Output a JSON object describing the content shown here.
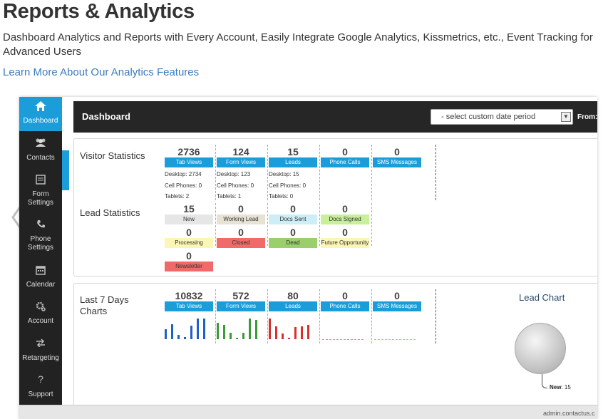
{
  "page": {
    "title": "Reports & Analytics",
    "description": "Dashboard Analytics and Reports with Every Account, Easily Integrate Google Analytics, Kissmetrics, etc., Event Tracking for Advanced Users",
    "link": "Learn More About Our Analytics Features"
  },
  "sidebar": {
    "items": [
      {
        "label": "Dashboard",
        "icon": "home-icon"
      },
      {
        "label": "Contacts",
        "icon": "users-icon"
      },
      {
        "label": "Form Settings",
        "icon": "form-icon"
      },
      {
        "label": "Phone Settings",
        "icon": "phone-icon"
      },
      {
        "label": "Calendar",
        "icon": "calendar-icon"
      },
      {
        "label": "Account",
        "icon": "gear-icon"
      },
      {
        "label": "Retargeting",
        "icon": "retarget-icon"
      },
      {
        "label": "Support",
        "icon": "question-icon"
      }
    ]
  },
  "header": {
    "title": "Dashboard",
    "date_select": "- select custom date period",
    "from_label": "From:"
  },
  "visitor_stats": {
    "label": "Visitor Statistics",
    "items": [
      {
        "value": "2736",
        "label": "Tab Views",
        "desktop": "Desktop: 2734",
        "cell": "Cell Phones: 0",
        "tablets": "Tablets: 2"
      },
      {
        "value": "124",
        "label": "Form Views",
        "desktop": "Desktop: 123",
        "cell": "Cell Phones: 0",
        "tablets": "Tablets: 1"
      },
      {
        "value": "15",
        "label": "Leads",
        "desktop": "Desktop: 15",
        "cell": "Cell Phones: 0",
        "tablets": "Tablets: 0"
      },
      {
        "value": "0",
        "label": "Phone Calls"
      },
      {
        "value": "0",
        "label": "SMS Messages"
      }
    ]
  },
  "lead_stats": {
    "label": "Lead Statistics",
    "items": [
      {
        "value": "15",
        "label": "New",
        "color": "#e6e6e6"
      },
      {
        "value": "0",
        "label": "Working Lead",
        "color": "#e8e2d4"
      },
      {
        "value": "0",
        "label": "Docs Sent",
        "color": "#cdeef6"
      },
      {
        "value": "0",
        "label": "Docs Signed",
        "color": "#c8ef9a"
      },
      {
        "value": "0",
        "label": "Processing",
        "color": "#fbf6b5"
      },
      {
        "value": "0",
        "label": "Closed",
        "color": "#f06a6a"
      },
      {
        "value": "0",
        "label": "Dead",
        "color": "#9bcf6c"
      },
      {
        "value": "0",
        "label": "Future Opportunity",
        "color": "#fbf6b5"
      },
      {
        "value": "0",
        "label": "Newsletter",
        "color": "#f06a6a"
      }
    ]
  },
  "charts": {
    "label": "Last 7 Days Charts",
    "items": [
      {
        "value": "10832",
        "label": "Tab Views",
        "color": "#1f5fcc",
        "bars": [
          0.45,
          0.7,
          0.2,
          0.1,
          0.62,
          0.95,
          0.95
        ]
      },
      {
        "value": "572",
        "label": "Form Views",
        "color": "#3a9a35",
        "bars": [
          0.75,
          0.65,
          0.3,
          0.05,
          0.3,
          0.95,
          0.9
        ]
      },
      {
        "value": "80",
        "label": "Leads",
        "color": "#d8302a",
        "bars": [
          0.95,
          0.6,
          0.25,
          0.05,
          0.55,
          0.6,
          0.65
        ]
      },
      {
        "value": "0",
        "label": "Phone Calls",
        "color": "#5bc0de"
      },
      {
        "value": "0",
        "label": "SMS Messages",
        "color": "#f0ad4e"
      }
    ]
  },
  "lead_chart": {
    "title": "Lead Chart",
    "slice_name": "New",
    "slice_value": ": 15"
  },
  "status_url": "admin.contactus.c"
}
